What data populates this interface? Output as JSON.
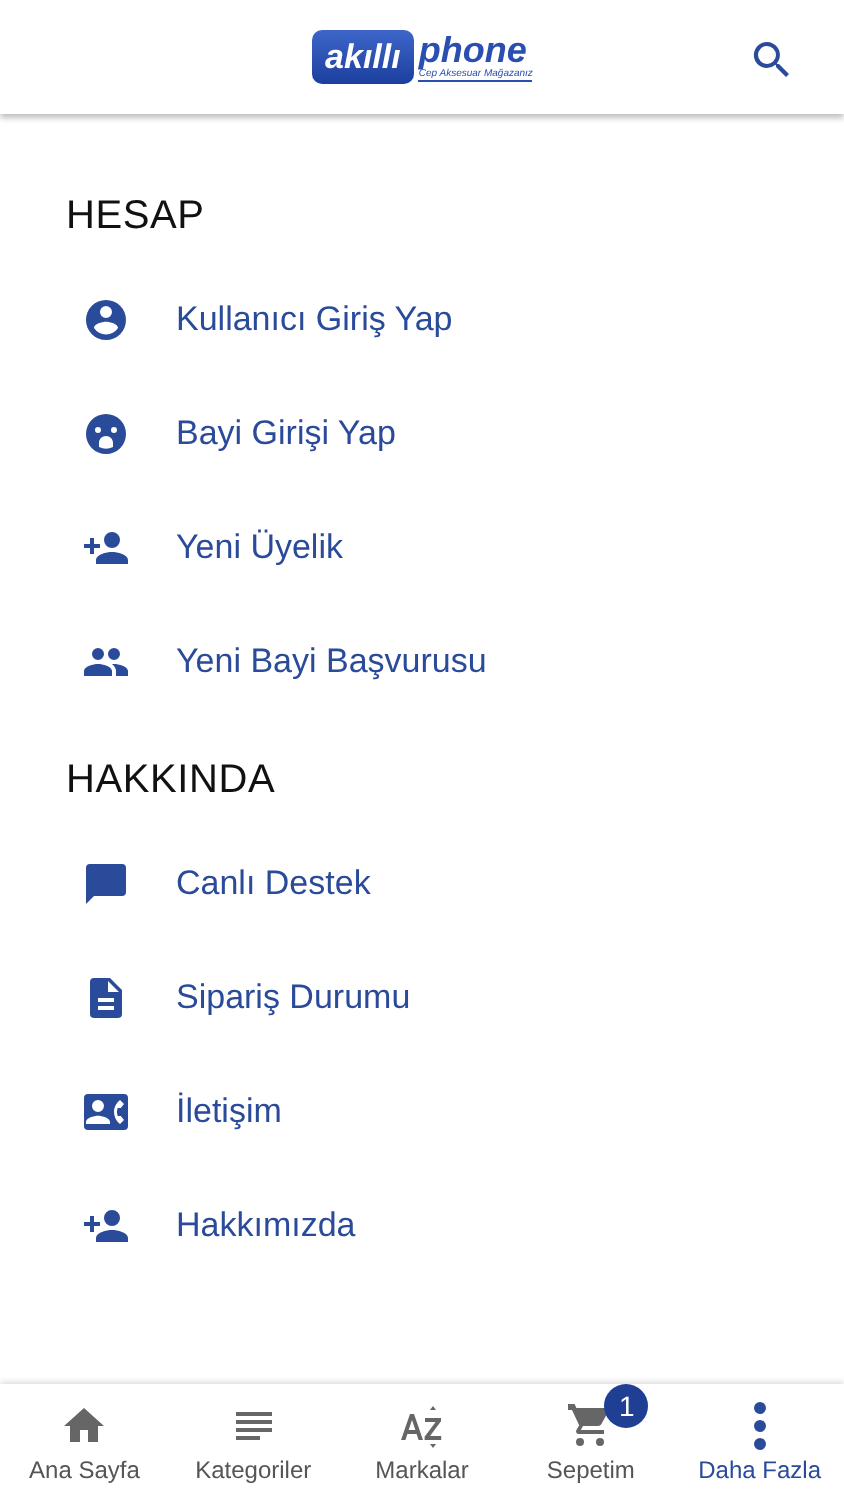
{
  "header": {
    "logo": {
      "badge": "akıllı",
      "word": "phone",
      "tagline": "Cep Aksesuar Mağazanız"
    }
  },
  "sections": [
    {
      "title": "HESAP",
      "items": [
        {
          "label": "Kullanıcı Giriş Yap",
          "kind": "account"
        },
        {
          "label": "Bayi Girişi Yap",
          "kind": "face"
        },
        {
          "label": "Yeni Üyelik",
          "kind": "person-add"
        },
        {
          "label": "Yeni Bayi Başvurusu",
          "kind": "people"
        }
      ]
    },
    {
      "title": "HAKKINDA",
      "items": [
        {
          "label": "Canlı Destek",
          "kind": "chat"
        },
        {
          "label": "Sipariş Durumu",
          "kind": "document"
        },
        {
          "label": "İletişim",
          "kind": "contact"
        },
        {
          "label": "Hakkımızda",
          "kind": "person-add"
        }
      ]
    }
  ],
  "bottom_nav": [
    {
      "label": "Ana Sayfa",
      "kind": "home",
      "selected": false
    },
    {
      "label": "Kategoriler",
      "kind": "list",
      "selected": false
    },
    {
      "label": "Markalar",
      "kind": "az",
      "selected": false
    },
    {
      "label": "Sepetim",
      "kind": "cart",
      "selected": false,
      "badge": "1"
    },
    {
      "label": "Daha Fazla",
      "kind": "more",
      "selected": true
    }
  ]
}
